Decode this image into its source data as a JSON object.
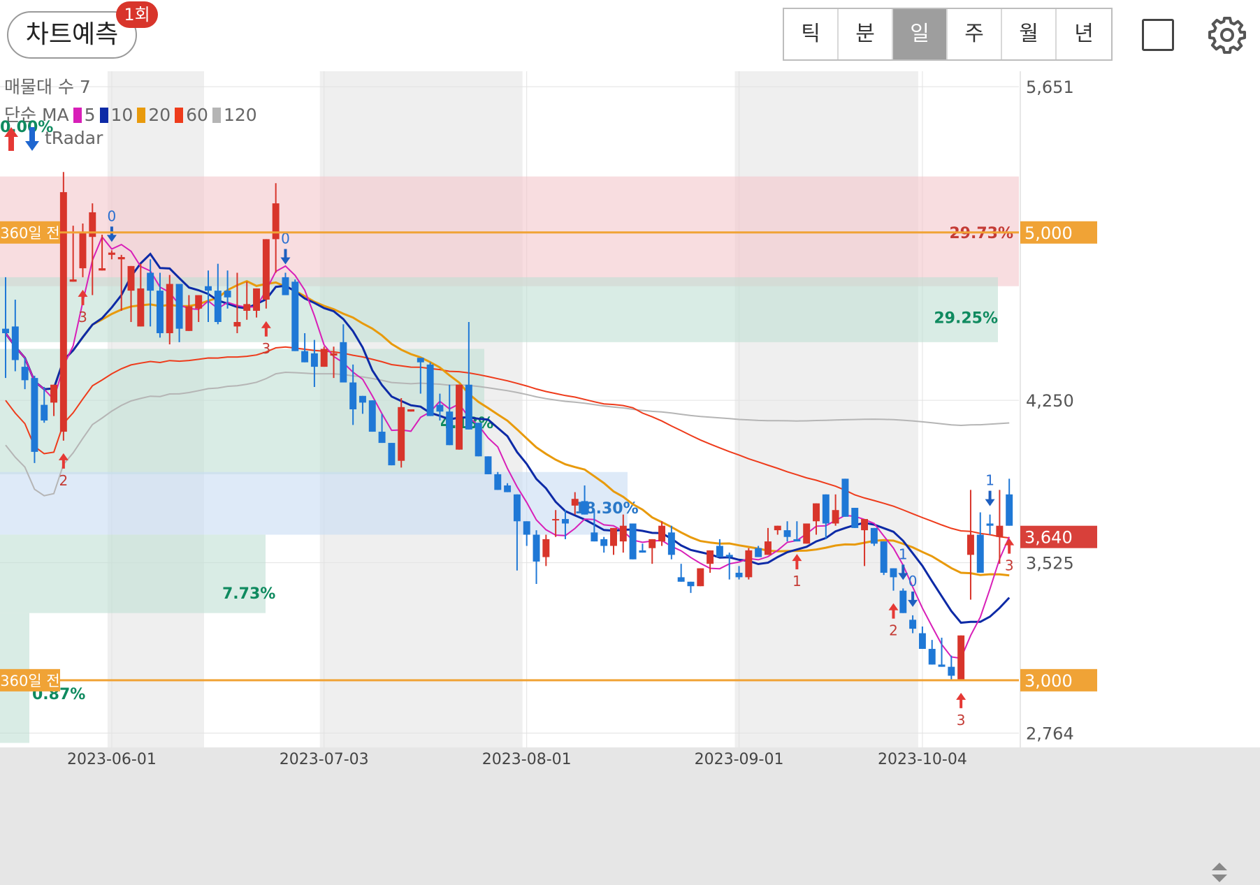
{
  "header": {
    "predict_label": "차트예측",
    "predict_badge": "1회",
    "periods": [
      "틱",
      "분",
      "일",
      "주",
      "월",
      "년"
    ],
    "active_period": "일"
  },
  "legend": {
    "volume_profile": "매물대 수 7",
    "ma_prefix": "단순 MA",
    "ma_items": [
      {
        "label": "5",
        "color": "#d81fb8"
      },
      {
        "label": "10",
        "color": "#0d2aa6"
      },
      {
        "label": "20",
        "color": "#e89a0c"
      },
      {
        "label": "60",
        "color": "#ee3b1b"
      },
      {
        "label": "120",
        "color": "#b5b5b5"
      }
    ],
    "tradar_pct": "0.00%",
    "tradar_label": "tRadar"
  },
  "colors": {
    "up": "#d8352b",
    "down": "#1f78d6",
    "ma5": "#d81fb8",
    "ma10": "#0d2aa6",
    "ma20": "#e89a0c",
    "ma60": "#ee3b1b",
    "ma120": "#b5b5b5",
    "line360": "#f0a336",
    "last_price": "#d8403a"
  },
  "chart_data": {
    "type": "candlestick",
    "ylim": [
      2700,
      5720
    ],
    "y_ticks": [
      {
        "label": "5,651",
        "value": 5651
      },
      {
        "label": "4,250",
        "value": 4250
      },
      {
        "label": "3,525",
        "value": 3525
      },
      {
        "label": "2,764",
        "value": 2764
      }
    ],
    "x_ticks": [
      {
        "label": "2023-06-01",
        "index": 11
      },
      {
        "label": "2023-07-03",
        "index": 33
      },
      {
        "label": "2023-08-01",
        "index": 54
      },
      {
        "label": "2023-09-01",
        "index": 76
      },
      {
        "label": "2023-10-04",
        "index": 95
      }
    ],
    "count": 105,
    "candles": [
      [
        4570,
        4800,
        4350,
        4550
      ],
      [
        4580,
        4700,
        4380,
        4430
      ],
      [
        4400,
        4440,
        4300,
        4340
      ],
      [
        4350,
        4360,
        3970,
        4020
      ],
      [
        4230,
        4310,
        4150,
        4160
      ],
      [
        4240,
        4310,
        4180,
        4320
      ],
      [
        4110,
        5270,
        4070,
        5180
      ],
      [
        4780,
        5030,
        4780,
        4790
      ],
      [
        4840,
        5040,
        4800,
        5000
      ],
      [
        4980,
        5130,
        4720,
        5090
      ],
      [
        4830,
        4990,
        4850,
        4840
      ],
      [
        4900,
        4920,
        4880,
        4910
      ],
      [
        4880,
        4900,
        4650,
        4890
      ],
      [
        4740,
        4850,
        4600,
        4850
      ],
      [
        4580,
        4860,
        4600,
        4750
      ],
      [
        4820,
        4880,
        4580,
        4740
      ],
      [
        4740,
        4820,
        4530,
        4550
      ],
      [
        4550,
        4810,
        4500,
        4770
      ],
      [
        4770,
        4760,
        4510,
        4570
      ],
      [
        4560,
        4720,
        4560,
        4670
      ],
      [
        4660,
        4720,
        4600,
        4720
      ],
      [
        4760,
        4830,
        4600,
        4740
      ],
      [
        4740,
        4860,
        4590,
        4600
      ],
      [
        4740,
        4830,
        4660,
        4710
      ],
      [
        4580,
        4820,
        4550,
        4600
      ],
      [
        4650,
        4780,
        4610,
        4680
      ],
      [
        4650,
        4750,
        4620,
        4750
      ],
      [
        4700,
        4960,
        4660,
        4970
      ],
      [
        4970,
        5220,
        4820,
        5130
      ],
      [
        4800,
        4820,
        4840,
        4720
      ],
      [
        4780,
        4790,
        4700,
        4470
      ],
      [
        4470,
        4550,
        4470,
        4420
      ],
      [
        4460,
        4520,
        4310,
        4400
      ],
      [
        4400,
        4490,
        4400,
        4480
      ],
      [
        4450,
        4490,
        4350,
        4460
      ],
      [
        4510,
        4590,
        4360,
        4330
      ],
      [
        4330,
        4410,
        4140,
        4210
      ],
      [
        4270,
        4270,
        4190,
        4240
      ],
      [
        4250,
        4250,
        4120,
        4110
      ],
      [
        4110,
        4190,
        4080,
        4060
      ],
      [
        4060,
        4040,
        3960,
        3960
      ],
      [
        3980,
        4260,
        3950,
        4220
      ],
      [
        4200,
        4200,
        4300,
        4210
      ],
      [
        4440,
        4440,
        4280,
        4420
      ],
      [
        4410,
        4420,
        4190,
        4180
      ],
      [
        4230,
        4280,
        4160,
        4200
      ],
      [
        4200,
        4320,
        4090,
        4050
      ],
      [
        4030,
        4180,
        4190,
        4320
      ],
      [
        4320,
        4600,
        4180,
        4120
      ],
      [
        4150,
        4090,
        4010,
        4000
      ],
      [
        4000,
        3980,
        3920,
        3920
      ],
      [
        3920,
        3930,
        3860,
        3850
      ],
      [
        3870,
        3880,
        3860,
        3840
      ],
      [
        3830,
        3780,
        3490,
        3710
      ],
      [
        3710,
        3710,
        3600,
        3650
      ],
      [
        3650,
        3670,
        3430,
        3530
      ],
      [
        3550,
        3650,
        3510,
        3630
      ],
      [
        3720,
        3760,
        3640,
        3720
      ],
      [
        3720,
        3760,
        3630,
        3700
      ],
      [
        3780,
        3840,
        3740,
        3810
      ],
      [
        3800,
        3870,
        3800,
        3740
      ],
      [
        3660,
        3760,
        3640,
        3620
      ],
      [
        3630,
        3640,
        3570,
        3600
      ],
      [
        3600,
        3610,
        3560,
        3680
      ],
      [
        3620,
        3740,
        3570,
        3690
      ],
      [
        3700,
        3690,
        3540,
        3540
      ],
      [
        3580,
        3610,
        3640,
        3570
      ],
      [
        3590,
        3620,
        3520,
        3630
      ],
      [
        3620,
        3710,
        3600,
        3690
      ],
      [
        3660,
        3690,
        3540,
        3560
      ],
      [
        3460,
        3520,
        3560,
        3440
      ],
      [
        3440,
        3330,
        3390,
        3420
      ],
      [
        3420,
        3470,
        3500,
        3500
      ],
      [
        3520,
        3560,
        3480,
        3580
      ],
      [
        3600,
        3630,
        3560,
        3550
      ],
      [
        3560,
        3570,
        3450,
        3550
      ],
      [
        3480,
        3510,
        3450,
        3460
      ],
      [
        3460,
        3590,
        3450,
        3580
      ],
      [
        3590,
        3600,
        3580,
        3550
      ],
      [
        3560,
        3680,
        3580,
        3620
      ],
      [
        3670,
        3650,
        3650,
        3690
      ],
      [
        3670,
        3710,
        3620,
        3640
      ],
      [
        3630,
        3710,
        3720,
        3620
      ],
      [
        3610,
        3700,
        3610,
        3700
      ],
      [
        3710,
        3760,
        3650,
        3790
      ],
      [
        3830,
        3800,
        3630,
        3700
      ],
      [
        3700,
        3830,
        3690,
        3760
      ],
      [
        3900,
        3880,
        3790,
        3730
      ],
      [
        3770,
        3730,
        3740,
        3680
      ],
      [
        3670,
        3690,
        3510,
        3720
      ],
      [
        3680,
        3580,
        3600,
        3610
      ],
      [
        3620,
        3540,
        3470,
        3480
      ],
      [
        3500,
        3500,
        3400,
        3460
      ],
      [
        3400,
        3410,
        3340,
        3300
      ],
      [
        3270,
        3290,
        3210,
        3230
      ],
      [
        3210,
        3240,
        3170,
        3140
      ],
      [
        3140,
        3180,
        3090,
        3070
      ],
      [
        3070,
        3190,
        3130,
        3060
      ],
      [
        3060,
        3110,
        3000,
        3020
      ],
      [
        3000,
        3000,
        3000,
        3200
      ],
      [
        3560,
        3850,
        3360,
        3650
      ],
      [
        3650,
        3750,
        3540,
        3480
      ],
      [
        3700,
        3740,
        3650,
        3690
      ],
      [
        3640,
        3850,
        3520,
        3690
      ],
      [
        3830,
        3900,
        3740,
        3690
      ]
    ],
    "ma_note": "moving averages MA5, MA10, MA20, MA60, MA120",
    "lines_360": [
      {
        "label": "360일 전",
        "value": 5000
      },
      {
        "label": "360일 전",
        "value": 3000
      }
    ],
    "price_tags": [
      {
        "label": "5,000",
        "value": 5000
      },
      {
        "label": "3,640",
        "value": 3640
      },
      {
        "label": "3,000",
        "value": 3000
      }
    ],
    "zones": [
      {
        "label": "29.73%",
        "from": 4760,
        "to": 5250,
        "color": "#f4c6cb"
      },
      {
        "label": "29.25%",
        "from": 4510,
        "to": 4800,
        "color": "#bfe0d3"
      },
      {
        "label": "4.13%",
        "from": 3920,
        "to": 4480,
        "color": "#bfe0d3"
      },
      {
        "label": "18.30%",
        "from": 3650,
        "to": 3930,
        "color": "#c8dcf4"
      },
      {
        "label": "7.73%",
        "from": 3300,
        "to": 3650,
        "color": "#bfe0d3"
      },
      {
        "label": "0.87%",
        "from": 2720,
        "to": 3300,
        "color": "#bfe0d3"
      }
    ],
    "signals": [
      {
        "index": 6,
        "dir": "up",
        "label": "2"
      },
      {
        "index": 8,
        "dir": "up",
        "label": "3"
      },
      {
        "index": 11,
        "dir": "down",
        "label": "0"
      },
      {
        "index": 27,
        "dir": "up",
        "label": "3"
      },
      {
        "index": 29,
        "dir": "down",
        "label": "0"
      },
      {
        "index": 82,
        "dir": "up",
        "label": "1"
      },
      {
        "index": 92,
        "dir": "up",
        "label": "2"
      },
      {
        "index": 93,
        "dir": "down",
        "label": "1"
      },
      {
        "index": 94,
        "dir": "down",
        "label": "0"
      },
      {
        "index": 99,
        "dir": "up",
        "label": "3"
      },
      {
        "index": 102,
        "dir": "down",
        "label": "1"
      },
      {
        "index": 104,
        "dir": "up",
        "label": "3"
      }
    ]
  }
}
